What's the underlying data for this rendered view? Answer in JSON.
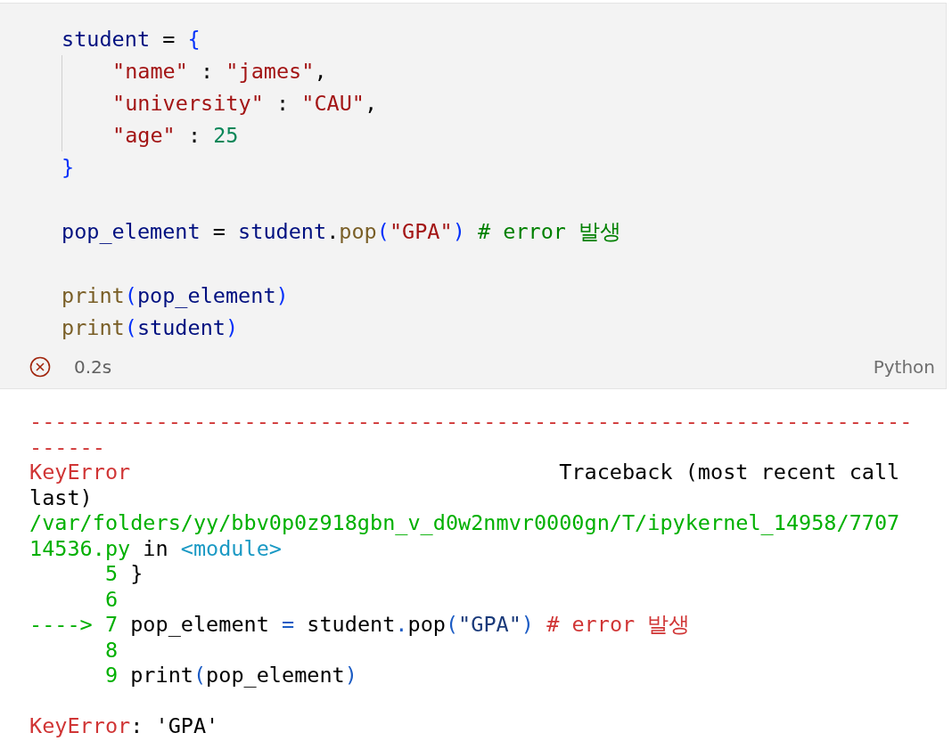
{
  "cell": {
    "code_blocks": [
      [
        {
          "tokens": [
            {
              "kind": "var",
              "text": "student"
            },
            {
              "kind": "punct",
              "text": " = "
            },
            {
              "kind": "brace",
              "text": "{"
            }
          ],
          "children": [
            {
              "tokens": [
                {
                  "kind": "str",
                  "text": "\"name\""
                },
                {
                  "kind": "punct",
                  "text": " : "
                },
                {
                  "kind": "str",
                  "text": "\"james\""
                },
                {
                  "kind": "punct",
                  "text": ","
                }
              ]
            },
            {
              "tokens": [
                {
                  "kind": "str",
                  "text": "\"university\""
                },
                {
                  "kind": "punct",
                  "text": " : "
                },
                {
                  "kind": "str",
                  "text": "\"CAU\""
                },
                {
                  "kind": "punct",
                  "text": ","
                }
              ]
            },
            {
              "tokens": [
                {
                  "kind": "str",
                  "text": "\"age\""
                },
                {
                  "kind": "punct",
                  "text": " : "
                },
                {
                  "kind": "num",
                  "text": "25"
                }
              ]
            }
          ]
        },
        {
          "tokens": [
            {
              "kind": "brace",
              "text": "}"
            }
          ]
        }
      ],
      [
        {
          "tokens": [
            {
              "kind": "var",
              "text": "pop_element"
            },
            {
              "kind": "punct",
              "text": " = "
            },
            {
              "kind": "var",
              "text": "student"
            },
            {
              "kind": "punct",
              "text": "."
            },
            {
              "kind": "func",
              "text": "pop"
            },
            {
              "kind": "brace",
              "text": "("
            },
            {
              "kind": "str",
              "text": "\"GPA\""
            },
            {
              "kind": "brace",
              "text": ") "
            },
            {
              "kind": "comment",
              "text": "# error 발생"
            }
          ]
        }
      ],
      [
        {
          "tokens": [
            {
              "kind": "func",
              "text": "print"
            },
            {
              "kind": "brace",
              "text": "("
            },
            {
              "kind": "var",
              "text": "pop_element"
            },
            {
              "kind": "brace",
              "text": ")"
            }
          ]
        },
        {
          "tokens": [
            {
              "kind": "func",
              "text": "print"
            },
            {
              "kind": "brace",
              "text": "("
            },
            {
              "kind": "var",
              "text": "student"
            },
            {
              "kind": "brace",
              "text": ")"
            }
          ]
        }
      ]
    ],
    "status": {
      "failed": true,
      "time": "0.2s"
    },
    "language": "Python"
  },
  "output": {
    "blocks": [
      [
        {
          "tokens": [
            {
              "kind": "red",
              "text": "----------------------------------------------------------------------"
            }
          ]
        },
        {
          "tokens": [
            {
              "kind": "red",
              "text": "------"
            }
          ]
        },
        {
          "tokens": [
            {
              "kind": "red",
              "text": "KeyError"
            },
            {
              "kind": "plain",
              "text": "                                  Traceback (most recent call"
            }
          ]
        },
        {
          "tokens": [
            {
              "kind": "plain",
              "text": "last)"
            }
          ]
        },
        {
          "tokens": [
            {
              "kind": "green",
              "text": "/var/folders/yy/bbv0p0z918gbn_v_d0w2nmvr0000gn/T/ipykernel_14958/7707"
            }
          ]
        },
        {
          "tokens": [
            {
              "kind": "green",
              "text": "14536.py"
            },
            {
              "kind": "plain",
              "text": " in "
            },
            {
              "kind": "cyan",
              "text": "<module>"
            }
          ]
        },
        {
          "tokens": [
            {
              "kind": "green",
              "text": "      5"
            },
            {
              "kind": "plain",
              "text": " }"
            }
          ]
        },
        {
          "tokens": [
            {
              "kind": "green",
              "text": "      6"
            }
          ]
        },
        {
          "tokens": [
            {
              "kind": "green",
              "text": "----> 7"
            },
            {
              "kind": "plain",
              "text": " pop_element "
            },
            {
              "kind": "blue",
              "text": "="
            },
            {
              "kind": "plain",
              "text": " student"
            },
            {
              "kind": "blue",
              "text": "."
            },
            {
              "kind": "plain",
              "text": "pop"
            },
            {
              "kind": "blue",
              "text": "("
            },
            {
              "kind": "navy",
              "text": "\"GPA\""
            },
            {
              "kind": "blue",
              "text": ") "
            },
            {
              "kind": "red",
              "text": "# error 발생"
            }
          ]
        },
        {
          "tokens": [
            {
              "kind": "green",
              "text": "      8"
            }
          ]
        },
        {
          "tokens": [
            {
              "kind": "green",
              "text": "      9"
            },
            {
              "kind": "plain",
              "text": " print"
            },
            {
              "kind": "blue",
              "text": "("
            },
            {
              "kind": "plain",
              "text": "pop_element"
            },
            {
              "kind": "blue",
              "text": ")"
            }
          ]
        }
      ],
      [
        {
          "tokens": [
            {
              "kind": "red",
              "text": "KeyError"
            },
            {
              "kind": "plain",
              "text": ": 'GPA'"
            }
          ]
        }
      ]
    ]
  }
}
